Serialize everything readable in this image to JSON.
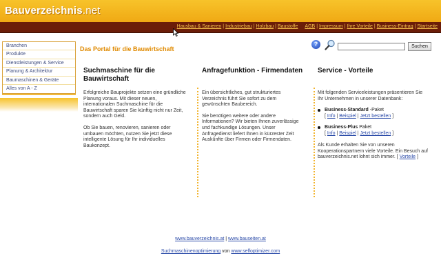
{
  "logo": {
    "main": "Bauverzeichnis",
    "tld": ".net"
  },
  "nav": {
    "group1": [
      "Hausbau & Sanieren",
      "Industriebau",
      "Holzbau",
      "Baustoffe"
    ],
    "group2": [
      "AGB",
      "Impressum",
      "Ihre Vorteile",
      "Business-Eintrag",
      "Startseite"
    ],
    "separator": "|"
  },
  "sidebar": {
    "items": [
      {
        "label": "Branchen"
      },
      {
        "label": "Produkte"
      },
      {
        "label": "Dienstleistungen & Service"
      },
      {
        "label": "Planung & Architektur"
      },
      {
        "label": "Baumaschinen & Geräte"
      },
      {
        "label": "Alles von A - Z"
      }
    ]
  },
  "portal_title": "Das Portal für die Bauwirtschaft",
  "search": {
    "value": "",
    "button_label": "Suchen",
    "help_label": "?"
  },
  "columns": {
    "col1": {
      "title": "Suchmaschine für die Bauwirtschaft",
      "p1": "Erfolgreiche Bauprojekte setzen eine gründliche Planung voraus. Mit dieser neuen, internationalen Suchmaschine für die Bauwirtschaft sparen Sie künftig nicht nur Zeit, sondern auch Geld.",
      "p2": "Ob Sie bauen, renovieren, sanieren oder umbauen möchten, nutzen Sie jetzt diese intelligente Lösung für Ihr individuelles Baukonzept."
    },
    "col2": {
      "title": "Anfragefunktion - Firmendaten",
      "p1": "Ein übersichtliches, gut strukturiertes Verzeichnis führt Sie sofort zu dem gewünschten Baubereich.",
      "p2": "Sie benötigen weitere oder andere Informationen? Wir bieten Ihnen zuverlässige und fachkundige Lösungen. Unser Anfragedienst liefert Ihnen in kürzester Zeit Auskünfte über Firmen oder Firmendaten."
    },
    "col3": {
      "title": "Service - Vorteile",
      "intro": "Mit folgenden Serviceleistungen präsentieren Sie Ihr Unternehmen in unserer Datenbank:",
      "b1_name": "Business-Standard",
      "b1_suffix": " -Paket",
      "b2_name": "Business-Plus",
      "b2_suffix": " Paket",
      "link_info": "Info",
      "link_beispiel": "Beispiel",
      "link_bestellen": "Jetzt bestellen",
      "outro": "Als Kunde erhalten Sie von unseren Kooperationspartnern viele Vorteile. Ein Besuch auf bauverzeichnis.net lohnt sich immer.",
      "link_vorteile": "Vorteile"
    }
  },
  "footer": {
    "link1": "www.bauverzeichnis.at",
    "sep": " | ",
    "link2": "www.bauseiten.at",
    "link3": "Suchmaschinenoptimierung",
    "von": " von ",
    "link4": "www.selfoptimizer.com"
  },
  "colors": {
    "header": "#f0a914",
    "navbar": "#6b1d09",
    "nav_text": "#f5c24b",
    "title_orange": "#e08a00",
    "link_blue": "#2a4aa8"
  }
}
